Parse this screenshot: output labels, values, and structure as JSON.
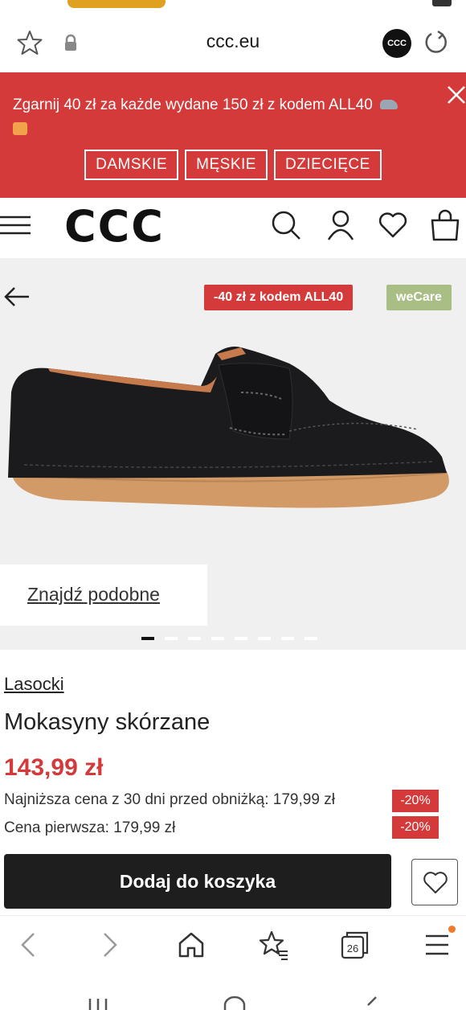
{
  "browser": {
    "url": "ccc.eu",
    "site_icon_label": "CCC"
  },
  "promo": {
    "text": "Zgarnij 40 zł za każde wydane 150 zł z kodem ALL40",
    "categories": [
      "DAMSKIE",
      "MĘSKIE",
      "DZIECIĘCE"
    ]
  },
  "header": {
    "logo": "CCC"
  },
  "gallery": {
    "sale_badge": "-40 zł z kodem ALL40",
    "care_badge": "weCare",
    "find_similar": "Znajdź podobne",
    "slides_total": 8,
    "slide_active": 1
  },
  "product": {
    "brand": "Lasocki",
    "name": "Mokasyny skórzane",
    "price": "143,99 zł",
    "lowest_price_label": "Najniższa cena z 30 dni przed obniżką: 179,99 zł",
    "lowest_price_discount": "-20%",
    "first_price_label": "Cena pierwsza: 179,99 zł",
    "first_price_discount": "-20%",
    "add_to_cart": "Dodaj do koszyka"
  },
  "bottom_nav": {
    "tabs_count": "26"
  },
  "colors": {
    "brand_red": "#d43a3a",
    "care_green": "#a9be85",
    "button_dark": "#1e1e1e",
    "notification": "#f07a2a"
  }
}
